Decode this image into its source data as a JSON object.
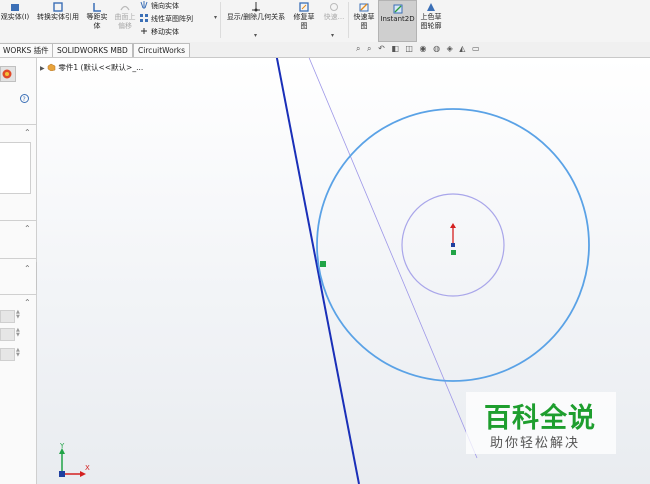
{
  "ribbon": {
    "convert_entities": "转换实体引用",
    "offset_entities_line1": "等距实",
    "offset_entities_line2": "体",
    "surface_offset_line1": "曲面上",
    "surface_offset_line2": "偏移",
    "mirror_entities": "镜向实体",
    "linear_pattern": "线性草图阵列",
    "move_entities": "移动实体",
    "display_relations": "显示/删除几何关系",
    "repair_sketch_line1": "修复草",
    "repair_sketch_line2": "图",
    "quick_snaps": "快速...",
    "rapid_sketch_line1": "快速草",
    "rapid_sketch_line2": "图",
    "instant2d": "Instant2D",
    "shaded_sketch_line1": "上色草",
    "shaded_sketch_line2": "图轮廓",
    "left_partial": "观实体(I)"
  },
  "tabs": [
    {
      "label": "WORKS 插件"
    },
    {
      "label": "SOLIDWORKS MBD"
    },
    {
      "label": "CircuitWorks"
    }
  ],
  "tree": {
    "part_label": "零件1 (默认<<默认>_..."
  },
  "axis": {
    "y_label": "Y",
    "x_label": "X"
  },
  "watermark": {
    "title": "百科全说",
    "subtitle": "助你轻松解决"
  },
  "colors": {
    "sketch_line": "#1a2fb8",
    "circle": "#5aa2e6",
    "inner_circle": "#a9a6ea",
    "construction_line": "#9e98e8",
    "watermark_green": "#1e9e2e"
  }
}
